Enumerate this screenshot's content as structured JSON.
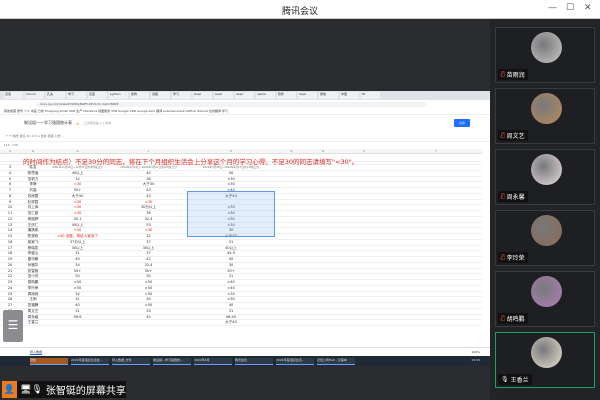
{
  "window": {
    "title": "腾讯会议",
    "minimize": "—",
    "maximize": "☐",
    "close": "✕"
  },
  "browser": {
    "tabs": [
      "百度",
      "Chrom",
      "孔夫",
      "学习",
      "百度",
      "python",
      "搜狗",
      "远程",
      "学习",
      "Aspir",
      "Aspir",
      "Aspir",
      "aspire",
      "软件",
      "Aspir",
      "微信",
      "中国",
      "Ht"
    ],
    "address": "docs.qq.com/sheet/DWWpBaEFLSEV2cUc-tab=BB08",
    "bookmarks": "其他收藏  账号  个人  中医  日常  Shopping  email  OKR  生产  literature  地图服务  VPN  Google  CRD  Google Rich  翻译  entertainment  GitHub Tutorial  在线翻译  学习",
    "doc_title": "制设组——学习强国统计表",
    "doc_status": "上次修改是 4 小时前",
    "share_label": "分享",
    "toolbar": "↶ ↷ 格式 默认 B I U S A 合并 筛选 公式 ...",
    "cell_ref": "L13",
    "fx": "<30"
  },
  "sheet": {
    "columns": [
      "A",
      "G",
      "G",
      "L",
      "P",
      "Q",
      "R",
      "S",
      "T"
    ],
    "banner": "的时间作为结点）不足30分的同志，将在下个月组织生活会上分享这个月的学习心得。不足30的同志请填写\"<30\"。",
    "header_row": {
      "num": "3",
      "name": "姓名",
      "c1": "2021年11月28日~12月27日的平均每日分",
      "c2": "2022年2月14日~2022年3月21日的平均每日分",
      "c3": "2022年3月28日~2022年4月27日的平均每日分"
    },
    "rows": [
      {
        "num": "4",
        "name": "陈思涵",
        "c1": "40以上",
        "c2": "40",
        "c3": "40"
      },
      {
        "num": "5",
        "name": "范帆力",
        "c1": "32",
        "c2": "38",
        "c3": "<30"
      },
      {
        "num": "6",
        "name": "李静",
        "c1": "<30",
        "c2": "大于30",
        "c3": "<30",
        "r1": true
      },
      {
        "num": "7",
        "name": "刘高",
        "c1": "50+",
        "c2": "43",
        "c3": ">40"
      },
      {
        "num": "8",
        "name": "苏雨霞",
        "c1": "大于40",
        "c2": "43",
        "c3": "大于40"
      },
      {
        "num": "9",
        "name": "杜祥园",
        "c1": "<30",
        "c2": "<30",
        "c3": "",
        "r1": true,
        "r2": true
      },
      {
        "num": "10",
        "name": "刘上泽",
        "c1": "<30",
        "c2": "30分以上",
        "c3": "<30",
        "r1": true
      },
      {
        "num": "11",
        "name": "范仁超",
        "c1": "<30",
        "c2": "38",
        "c3": "<30",
        "r1": true
      },
      {
        "num": "12",
        "name": "杨朋婷",
        "c1": "30.1",
        "c2": "32.4",
        "c3": "<30"
      },
      {
        "num": "13",
        "name": "王庆仁",
        "c1": "40以上",
        "c2": "53",
        "c3": "<30"
      },
      {
        "num": "14",
        "name": "蒲扬帆",
        "c1": "<30",
        "c2": "<30",
        "c3": "30",
        "r1": true,
        "r2": true
      },
      {
        "num": "15",
        "name": "陈秀栋",
        "c1": "<30 没做，再给人家讲了",
        "c2": "32",
        "c3": "小于30",
        "r1": true
      },
      {
        "num": "16",
        "name": "吴家飞",
        "c1": "37分以上",
        "c2": "37",
        "c3": "31"
      },
      {
        "num": "17",
        "name": "杨瑞凯",
        "c1": "30以上",
        "c2": "30以上",
        "c3": "40以上"
      },
      {
        "num": "18",
        "name": "李盛山",
        "c1": "31",
        "c2": "37",
        "c3": "44.5"
      },
      {
        "num": "19",
        "name": "唐可敏",
        "c1": "40",
        "c2": "42",
        "c3": "40"
      },
      {
        "num": "20",
        "name": "孙雅华",
        "c1": "34",
        "c2": "32.4",
        "c3": "30"
      },
      {
        "num": "21",
        "name": "张智铤",
        "c1": "50+",
        "c2": "50+",
        "c3": "50+"
      },
      {
        "num": "22",
        "name": "范小芳",
        "c1": "30",
        "c2": "30",
        "c3": "31"
      },
      {
        "num": "23",
        "name": "胡鸣鹏",
        "c1": ">50",
        "c2": ">50",
        "c3": ">40"
      },
      {
        "num": "24",
        "name": "李玲荣",
        "c1": ">50",
        "c2": ">50",
        "c3": ">40"
      },
      {
        "num": "25",
        "name": "周雨润",
        "c1": "32",
        "c2": ">50",
        "c3": "<30"
      },
      {
        "num": "26",
        "name": "王雨",
        "c1": "31",
        "c2": "30",
        "c3": "<30"
      },
      {
        "num": "27",
        "name": "张福腾",
        "c1": "40",
        "c2": ">50",
        "c3": "40"
      },
      {
        "num": "28",
        "name": "周文艺",
        "c1": "31",
        "c2": "33",
        "c3": "31"
      },
      {
        "num": "29",
        "name": "周永馨",
        "c1": "56.6",
        "c2": "45",
        "c3": "46.45"
      },
      {
        "num": "30",
        "name": "王香兰",
        "c1": "",
        "c2": "",
        "c3": "大于40"
      }
    ],
    "sheet_tab": "导入数据",
    "zoom": "100%"
  },
  "taskbar": [
    "微信",
    "2021年度组织生活会...",
    "导入数据_文件",
    "制设组—学习强国统...",
    "2022年4月",
    "腾讯会议",
    "2021年度组织生活...",
    "记住公司Hall - 记事本"
  ],
  "taskbar_time": "15:03",
  "sharer": "张智铤的屏幕共享",
  "participants": [
    {
      "name": "苗雨润",
      "muted": true,
      "color": "#c8c8c8"
    },
    {
      "name": "周文艺",
      "muted": true,
      "color": "#b98a5a"
    },
    {
      "name": "周永馨",
      "muted": true,
      "color": "#e8dce0"
    },
    {
      "name": "李玲荣",
      "muted": true,
      "color": "#8a6a55"
    },
    {
      "name": "胡鸣鹏",
      "muted": true,
      "color": "#b07fb8"
    },
    {
      "name": "王香兰",
      "muted": false,
      "active": true,
      "color": "#e9e1cf"
    }
  ],
  "colors": {
    "accent": "#1fa35a",
    "red_text": "#e2231a",
    "share_orange": "#f07b19"
  }
}
